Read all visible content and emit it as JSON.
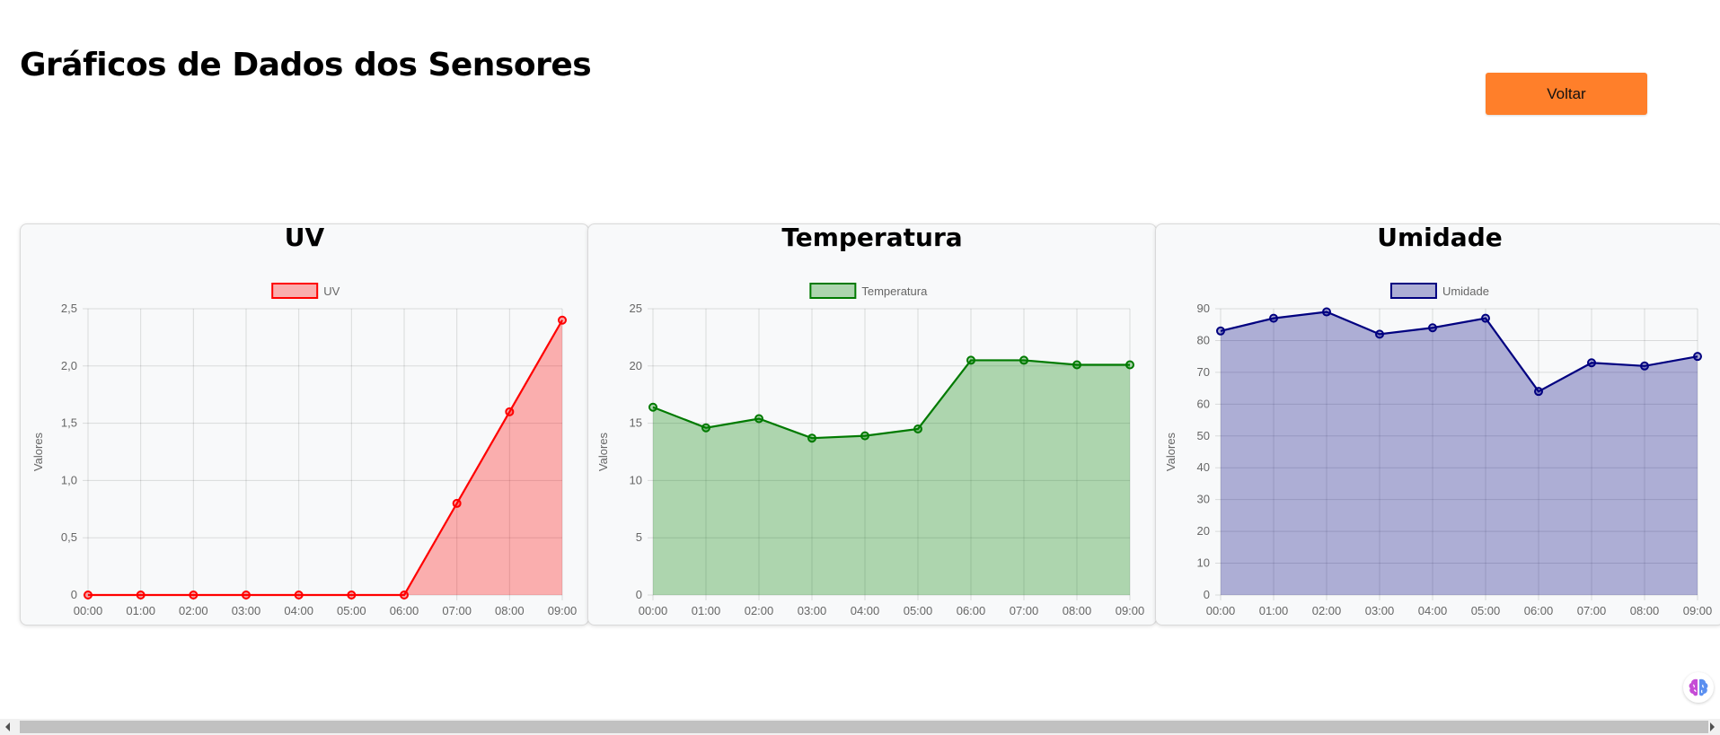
{
  "page": {
    "title": "Gráficos de Dados dos Sensores",
    "back_label": "Voltar"
  },
  "chart_data": [
    {
      "type": "area",
      "title": "UV",
      "ylabel": "Valores",
      "xlabel": "",
      "categories": [
        "00:00",
        "01:00",
        "02:00",
        "03:00",
        "04:00",
        "05:00",
        "06:00",
        "07:00",
        "08:00",
        "09:00"
      ],
      "series": [
        {
          "name": "UV",
          "values": [
            0,
            0,
            0,
            0,
            0,
            0,
            0,
            0.8,
            1.6,
            2.4
          ]
        }
      ],
      "ylim": [
        0,
        2.5
      ],
      "yticks": [
        "0",
        "0,5",
        "1,0",
        "1,5",
        "2,0",
        "2,5"
      ],
      "grid": true,
      "legend": "top",
      "colors": {
        "line": "#ff0000",
        "fill": "rgba(255,0,0,0.3)"
      }
    },
    {
      "type": "area",
      "title": "Temperatura",
      "ylabel": "Valores",
      "xlabel": "",
      "categories": [
        "00:00",
        "01:00",
        "02:00",
        "03:00",
        "04:00",
        "05:00",
        "06:00",
        "07:00",
        "08:00",
        "09:00"
      ],
      "series": [
        {
          "name": "Temperatura",
          "values": [
            16.4,
            14.6,
            15.4,
            13.7,
            13.9,
            14.5,
            20.5,
            20.5,
            20.1,
            20.1
          ]
        }
      ],
      "ylim": [
        0,
        25
      ],
      "yticks": [
        "0",
        "5",
        "10",
        "15",
        "20",
        "25"
      ],
      "grid": true,
      "legend": "top",
      "colors": {
        "line": "#007a00",
        "fill": "rgba(0,128,0,0.3)"
      }
    },
    {
      "type": "area",
      "title": "Umidade",
      "ylabel": "Valores",
      "xlabel": "",
      "categories": [
        "00:00",
        "01:00",
        "02:00",
        "03:00",
        "04:00",
        "05:00",
        "06:00",
        "07:00",
        "08:00",
        "09:00"
      ],
      "series": [
        {
          "name": "Umidade",
          "values": [
            83,
            87,
            89,
            82,
            84,
            87,
            64,
            73,
            72,
            75
          ]
        }
      ],
      "ylim": [
        0,
        90
      ],
      "yticks": [
        "0",
        "10",
        "20",
        "30",
        "40",
        "50",
        "60",
        "70",
        "80",
        "90"
      ],
      "grid": true,
      "legend": "top",
      "colors": {
        "line": "#000080",
        "fill": "rgba(0,0,128,0.3)"
      }
    }
  ],
  "icons": {
    "assistant": "brain-icon"
  }
}
